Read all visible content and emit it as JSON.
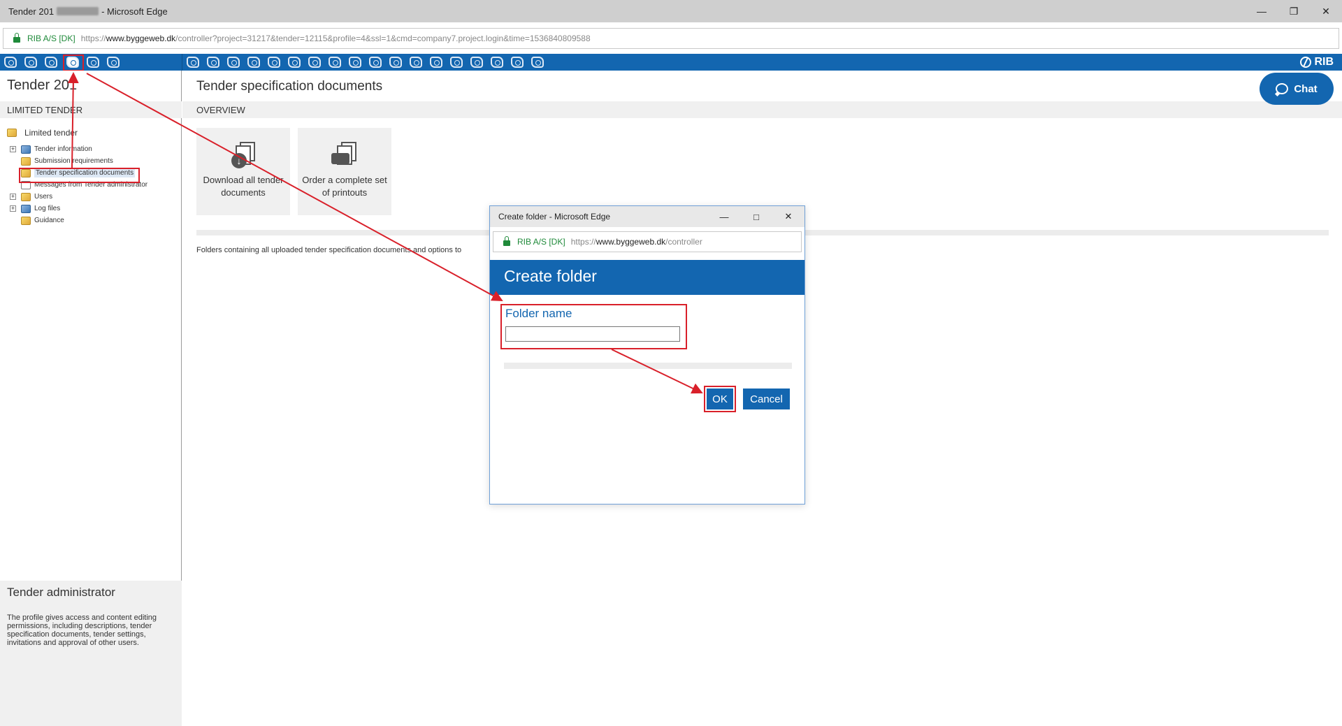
{
  "browser": {
    "title_prefix": "Tender 201",
    "title_suffix": "- Microsoft Edge",
    "site_id": "RIB A/S [DK]",
    "url_proto": "https://",
    "url_host": "www.byggeweb.dk",
    "url_rest": "/controller?project=31217&tender=12115&profile=4&ssl=1&cmd=company7.project.login&time=1536840809588"
  },
  "toolbar": {
    "brand": "RIB"
  },
  "left": {
    "title": "Tender 201",
    "subtitle": "LIMITED TENDER",
    "tree_root": "Limited tender",
    "tree": [
      {
        "label": "Tender information",
        "expandable": true
      },
      {
        "label": "Submission requirements",
        "expandable": false
      },
      {
        "label": "Tender specification documents",
        "expandable": false,
        "selected": true
      },
      {
        "label": "Messages from Tender administrator",
        "expandable": false
      },
      {
        "label": "Users",
        "expandable": true
      },
      {
        "label": "Log files",
        "expandable": true
      },
      {
        "label": "Guidance",
        "expandable": false
      }
    ],
    "admin_title": "Tender administrator",
    "admin_text": "The profile gives access and content editing permissions, including descriptions, tender specification documents, tender settings, invitations and approval of other users."
  },
  "main": {
    "title": "Tender specification documents",
    "subtitle": "OVERVIEW",
    "tiles": [
      {
        "label": "Download all tender documents"
      },
      {
        "label": "Order a complete set of printouts"
      }
    ],
    "description": "Folders containing all uploaded tender specification documents and options to",
    "chat_label": "Chat"
  },
  "dialog": {
    "window_title": "Create folder - Microsoft Edge",
    "site_id": "RIB A/S [DK]",
    "url_proto": "https://",
    "url_host": "www.byggeweb.dk",
    "url_rest": "/controller",
    "header": "Create folder",
    "field_label": "Folder name",
    "field_value": "",
    "ok_label": "OK",
    "cancel_label": "Cancel"
  },
  "colors": {
    "accent": "#1366b0",
    "highlight": "#d9202a",
    "secure": "#1f8a3a"
  }
}
